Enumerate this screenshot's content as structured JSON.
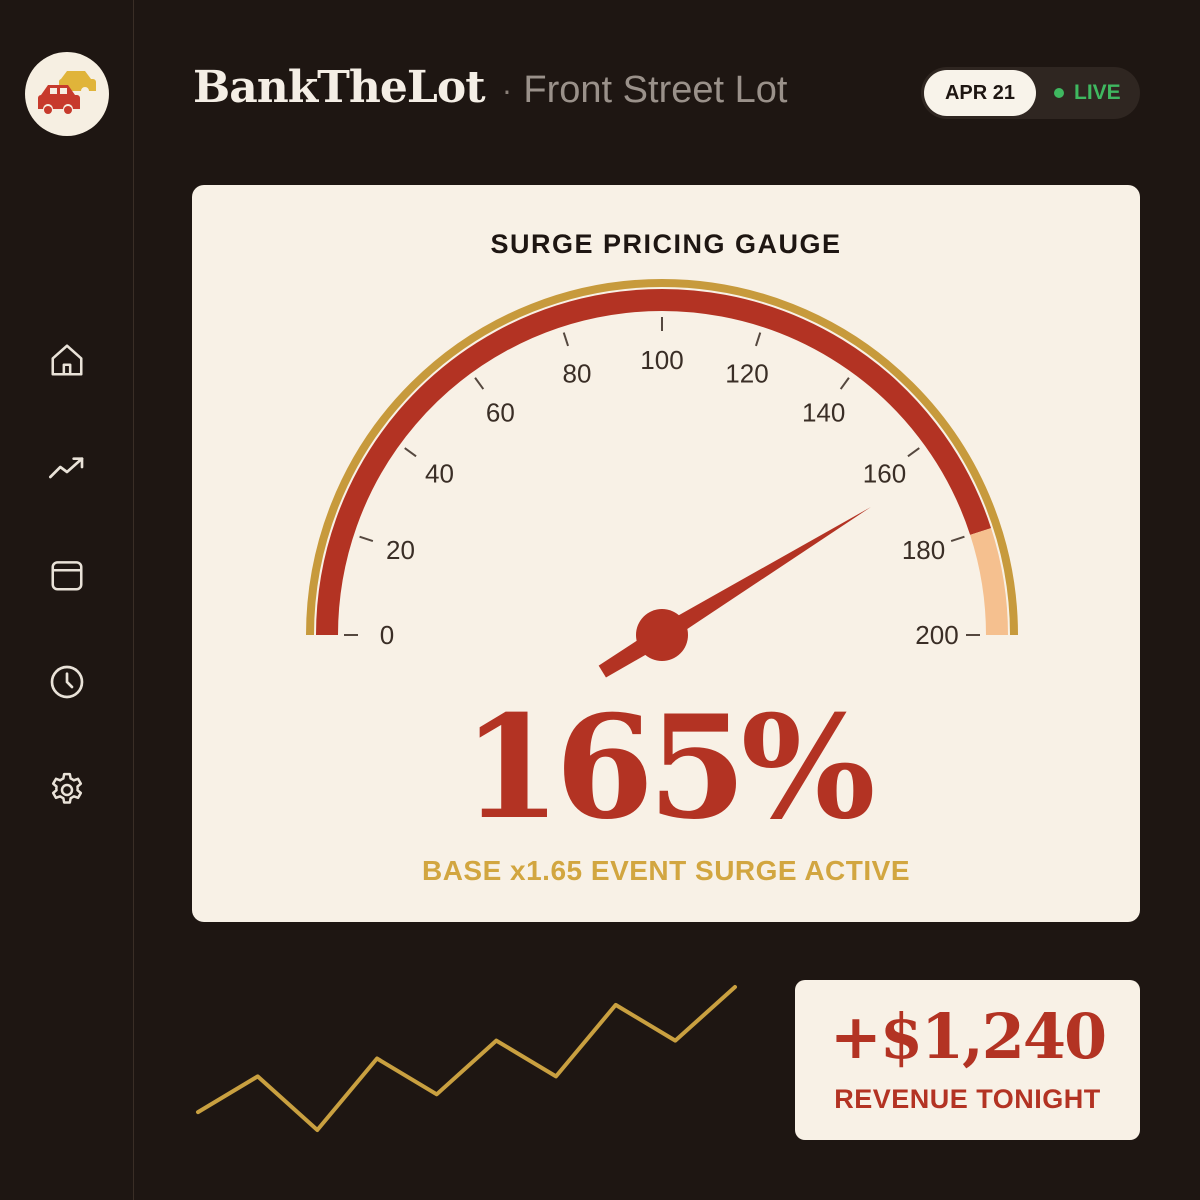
{
  "app": {
    "brand": "BankTheLot",
    "separator": "·",
    "lot_name": "Front Street Lot"
  },
  "status": {
    "date": "APR 21",
    "live_label": "LIVE",
    "live_color": "#3fb860"
  },
  "sidebar": {
    "logo_icon": "cars-icon",
    "items": [
      {
        "icon": "home-icon"
      },
      {
        "icon": "trend-icon"
      },
      {
        "icon": "calendar-icon"
      },
      {
        "icon": "clock-icon"
      },
      {
        "icon": "settings-icon"
      }
    ]
  },
  "gauge": {
    "title": "SURGE PRICING GAUGE",
    "min": 0,
    "max": 200,
    "ticks": [
      0,
      20,
      40,
      60,
      80,
      100,
      120,
      140,
      160,
      180,
      200
    ],
    "value": 165,
    "display_value": "165%",
    "subtitle": "BASE x1.65 EVENT SURGE ACTIVE",
    "danger_from": 180,
    "colors": {
      "arc": "#b33323",
      "danger": "#f5c08f",
      "rim": "#c79a3c",
      "needle": "#b33323"
    }
  },
  "revenue": {
    "value": "+$1,240",
    "label": "REVENUE TONIGHT"
  },
  "trend": {
    "values": [
      2,
      4,
      1,
      5,
      3,
      6,
      4,
      8,
      6,
      9
    ],
    "color": "#c9a040"
  }
}
